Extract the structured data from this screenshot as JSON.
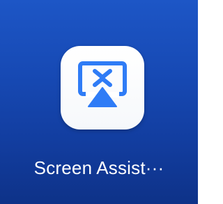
{
  "home_screen": {
    "app": {
      "label": "Screen Assist···",
      "icon": "screen-cast-icon",
      "icon_accent_color": "#2f7cf6",
      "tile_color": "#ffffff"
    },
    "wallpaper_color": "#1a4fbd"
  }
}
